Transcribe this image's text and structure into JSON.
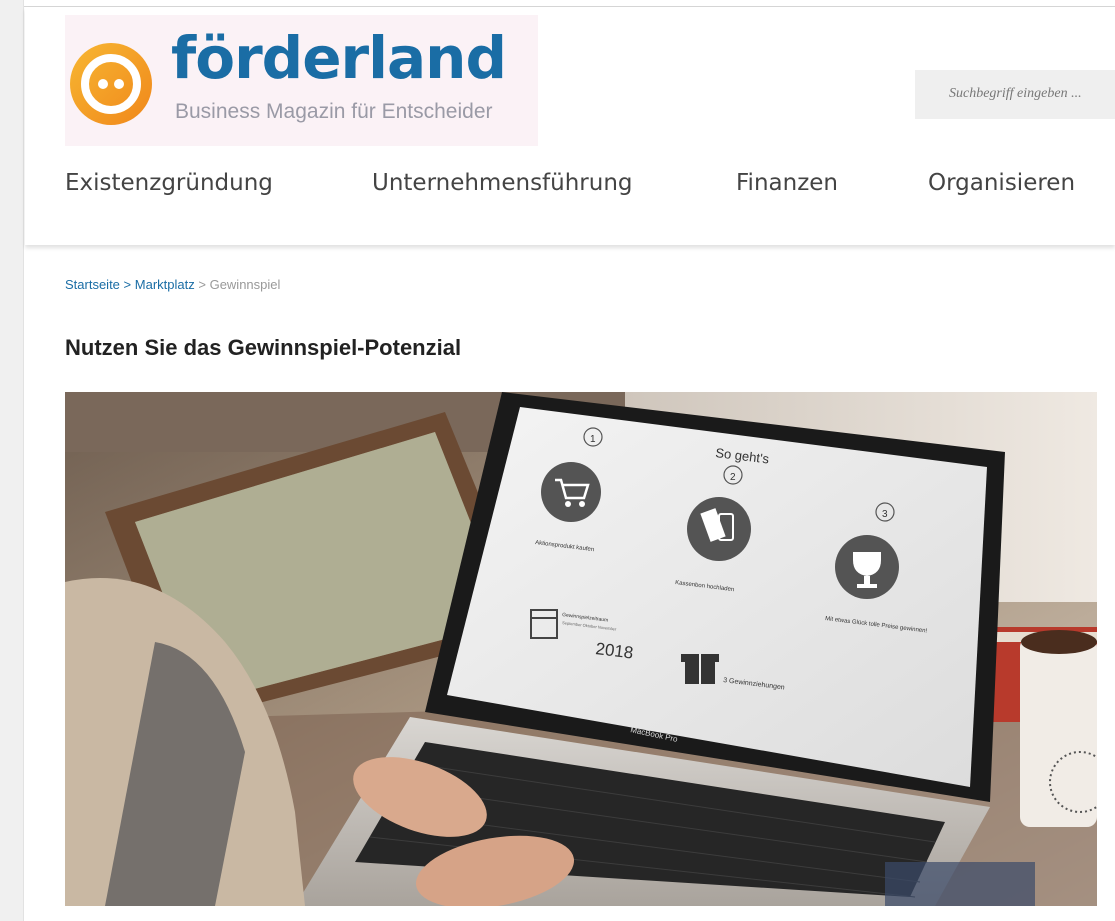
{
  "logo": {
    "wordmark": "förderland",
    "tagline": "Business Magazin für Entscheider"
  },
  "search": {
    "placeholder": "Suchbegriff eingeben ..."
  },
  "nav": {
    "items": [
      {
        "label": "Existenzgründung"
      },
      {
        "label": "Unternehmensführung"
      },
      {
        "label": "Finanzen"
      },
      {
        "label": "Organisieren"
      }
    ]
  },
  "breadcrumb": {
    "home": "Startseite",
    "separator": ">",
    "section": "Marktplatz",
    "current": "Gewinnspiel"
  },
  "page_title": "Nutzen Sie das Gewinnspiel-Potenzial",
  "hero": {
    "screen_heading": "So geht's",
    "steps": [
      {
        "number": "1",
        "icon": "cart-icon",
        "caption": "Aktionsprodukt kaufen"
      },
      {
        "number": "2",
        "icon": "receipt-phone-icon",
        "caption": "Kassenbon hochladen"
      },
      {
        "number": "3",
        "icon": "trophy-icon",
        "caption": "Mit etwas Glück tolle Preise gewinnen!"
      }
    ],
    "period_label": "Gewinnspielzeitraum",
    "period_months": "September Oktober November",
    "year": "2018",
    "draws_label": "3 Gewinnziehungen",
    "laptop_brand": "MacBook Pro"
  },
  "colors": {
    "brand_blue": "#1a6da5",
    "logo_orange": "#f39a1e",
    "logo_yellow": "#f9c23c"
  }
}
